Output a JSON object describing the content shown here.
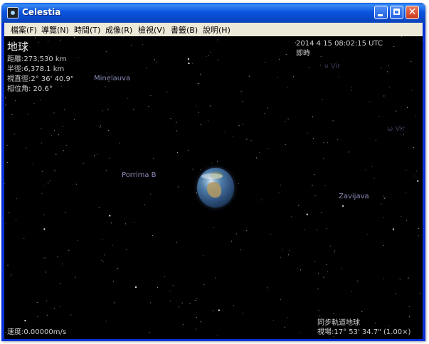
{
  "window": {
    "title": "Celestia"
  },
  "menu": {
    "items": [
      {
        "label": "檔案(F)"
      },
      {
        "label": "導覽(N)"
      },
      {
        "label": "時間(T)"
      },
      {
        "label": "成像(R)"
      },
      {
        "label": "檢視(V)"
      },
      {
        "label": "書籤(B)"
      },
      {
        "label": "說明(H)"
      }
    ]
  },
  "object_info": {
    "name": "地球",
    "distance": "距離:273,530 km",
    "radius": "半徑:6,378.1 km",
    "apparent_diameter": "視直徑:2° 36' 40.9\"",
    "phase_angle": "相位角: 20.6°"
  },
  "time": {
    "datetime": "2014 4 15 08:02:15 UTC",
    "mode": "即時"
  },
  "star_labels": {
    "minelauva": "Minelauva",
    "porrima": "Porrima B",
    "zavijava": "Zavijava",
    "vir_top": "ν Vir",
    "vir_right": "ω Vir"
  },
  "status": {
    "speed": "速度:0.00000m/s",
    "follow": "同步軌道地球",
    "fov": "視場:17° 53' 34.7\" (1.00×)"
  }
}
